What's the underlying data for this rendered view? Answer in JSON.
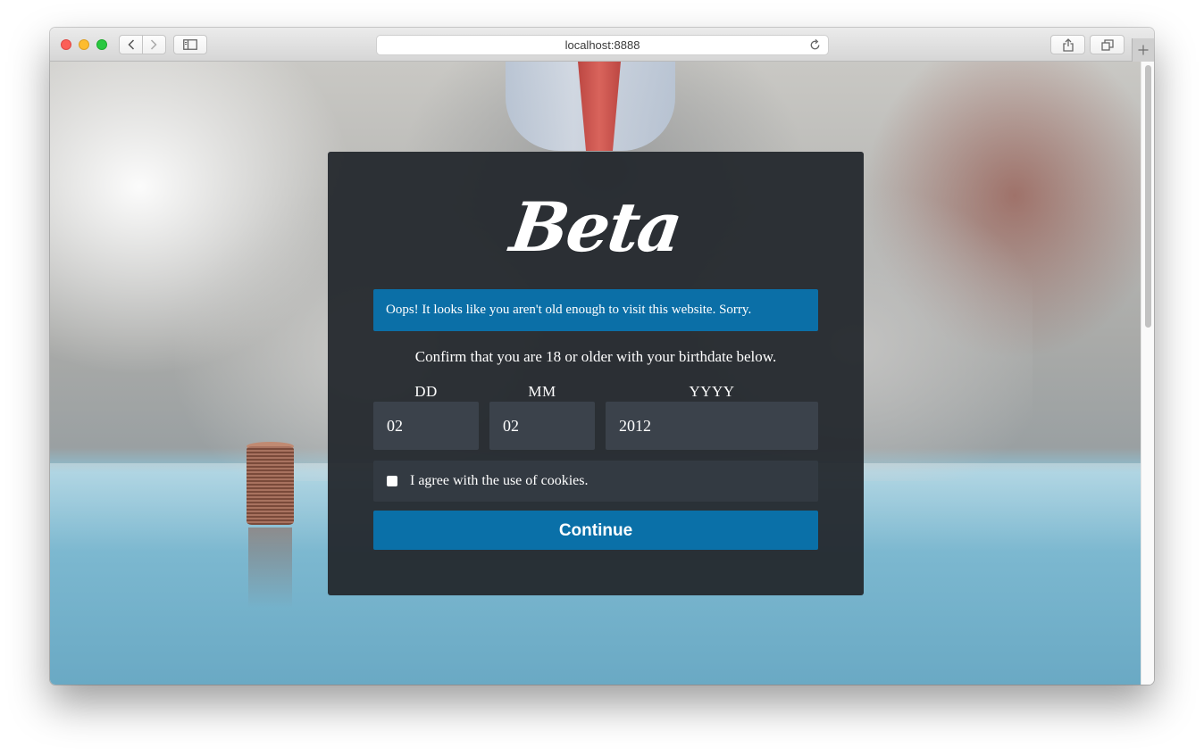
{
  "browser": {
    "url": "localhost:8888"
  },
  "modal": {
    "logo_text": "Beta",
    "alert_message": "Oops! It looks like you aren't old enough to visit this website. Sorry.",
    "instruction": "Confirm that you are 18 or older with your birthdate below.",
    "fields": {
      "day": {
        "label": "DD",
        "value": "02"
      },
      "month": {
        "label": "MM",
        "value": "02"
      },
      "year": {
        "label": "YYYY",
        "value": "2012"
      }
    },
    "cookie_consent": {
      "label": "I agree with the use of cookies.",
      "checked": false
    },
    "continue_label": "Continue"
  },
  "colors": {
    "alert_bg": "#0b6fa7",
    "button_bg": "#0a70a8",
    "modal_bg": "#23272d"
  }
}
